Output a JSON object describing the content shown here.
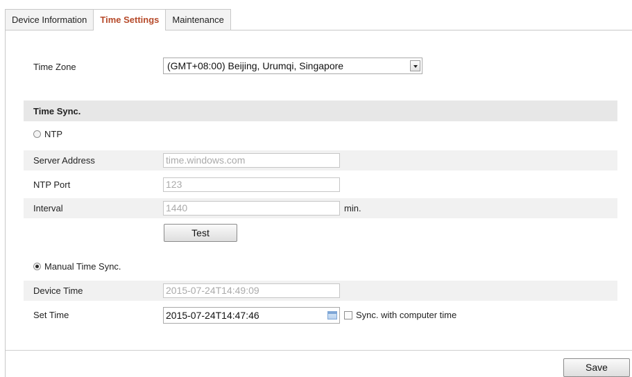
{
  "tabs": [
    {
      "label": "Device Information",
      "active": false
    },
    {
      "label": "Time Settings",
      "active": true
    },
    {
      "label": "Maintenance",
      "active": false
    }
  ],
  "time_zone": {
    "label": "Time Zone",
    "value": "(GMT+08:00) Beijing, Urumqi, Singapore"
  },
  "time_sync": {
    "heading": "Time Sync.",
    "ntp": {
      "label": "NTP",
      "selected": false,
      "server_address": {
        "label": "Server Address",
        "value": "time.windows.com"
      },
      "ntp_port": {
        "label": "NTP Port",
        "value": "123"
      },
      "interval": {
        "label": "Interval",
        "value": "1440",
        "unit": "min."
      },
      "test_label": "Test"
    },
    "manual": {
      "label": "Manual Time Sync.",
      "selected": true,
      "device_time": {
        "label": "Device Time",
        "value": "2015-07-24T14:49:09"
      },
      "set_time": {
        "label": "Set Time",
        "value": "2015-07-24T14:47:46"
      },
      "sync_computer": {
        "label": "Sync. with computer time",
        "checked": false
      }
    }
  },
  "footer": {
    "save_label": "Save"
  },
  "colors": {
    "active_tab_text": "#b64a2a",
    "section_bg": "#e7e7e7",
    "shaded_row": "#f1f1f1"
  },
  "icons": [
    "dropdown-arrow-icon",
    "calendar-icon"
  ]
}
